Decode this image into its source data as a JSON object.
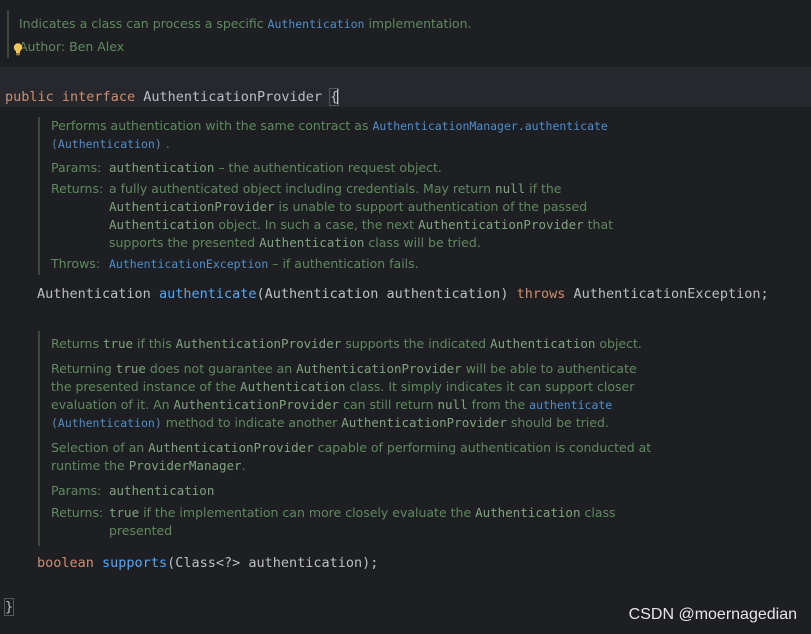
{
  "class_doc": {
    "desc_pre": "Indicates a class can process a specific ",
    "desc_link": "Authentication",
    "desc_post": " implementation.",
    "author_label": "Author:",
    "author_value": "Ben Alex"
  },
  "code": {
    "public": "public",
    "interface": "interface",
    "name": "AuthenticationProvider",
    "open_brace": "{",
    "close_brace": "}",
    "m1_ret": "Authentication",
    "m1_name": "authenticate",
    "m1_params": "(Authentication authentication)",
    "m1_throws": "throws",
    "m1_exc": "AuthenticationException;",
    "m2_ret": "boolean",
    "m2_name": "supports",
    "m2_params": "(Class<?> authentication);"
  },
  "doc1": {
    "p1_pre": "Performs authentication with the same contract as ",
    "p1_link": "AuthenticationManager.authenticate",
    "p1_link2": "(Authentication)",
    "p1_post": " .",
    "params_label": "Params:",
    "params_code": "authentication",
    "params_text": " – the authentication request object.",
    "returns_label": "Returns:",
    "r1": "a fully authenticated object including credentials. May return ",
    "r_null": "null",
    "r2": " if the",
    "r_provider": "AuthenticationProvider",
    "r3": " is unable to support authentication of the passed",
    "r_auth": "Authentication",
    "r4": " object. In such a case, the next ",
    "r_provider2": "AuthenticationProvider",
    "r5": " that",
    "r6": "supports the presented ",
    "r_auth2": "Authentication",
    "r7": " class will be tried.",
    "throws_label": "Throws:",
    "throws_link": "AuthenticationException",
    "throws_text": " – if authentication fails."
  },
  "doc2": {
    "a1": "Returns ",
    "a_true": "true",
    "a2": " if this ",
    "a_provider": "AuthenticationProvider",
    "a3": " supports the indicated ",
    "a_auth": "Authentication",
    "a4": " object.",
    "b1": "Returning ",
    "b_true": "true",
    "b2": " does not guarantee an ",
    "b_provider": "AuthenticationProvider",
    "b3": " will be able to authenticate",
    "b4": "the presented instance of the ",
    "b_auth": "Authentication",
    "b5": " class. It simply indicates it can support closer",
    "b6": "evaluation of it. An ",
    "b_provider2": "AuthenticationProvider",
    "b7": " can still return ",
    "b_null": "null",
    "b8": " from the ",
    "b_link": "authenticate",
    "b_link2": "(Authentication)",
    "b9": " method to indicate another ",
    "b_provider3": "AuthenticationProvider",
    "b10": " should be tried.",
    "c1": "Selection of an ",
    "c_provider": "AuthenticationProvider",
    "c2": " capable of performing authentication is conducted at",
    "c3": "runtime the ",
    "c_pm": "ProviderManager",
    "c4": ".",
    "params_label": "Params:",
    "params_code": "authentication",
    "returns_label": "Returns:",
    "ret_true": "true",
    "ret1": " if the implementation can more closely evaluate the ",
    "ret_auth": "Authentication",
    "ret2": " class",
    "ret3": "presented"
  },
  "watermark": "CSDN @moernagedian",
  "icons": {
    "intention": "lightbulb-icon"
  },
  "colors": {
    "background": "#1e1f22",
    "keyword": "#cf8e6d",
    "method": "#56a8f5",
    "doc": "#5f8a5f",
    "link": "#4e8fcc"
  }
}
